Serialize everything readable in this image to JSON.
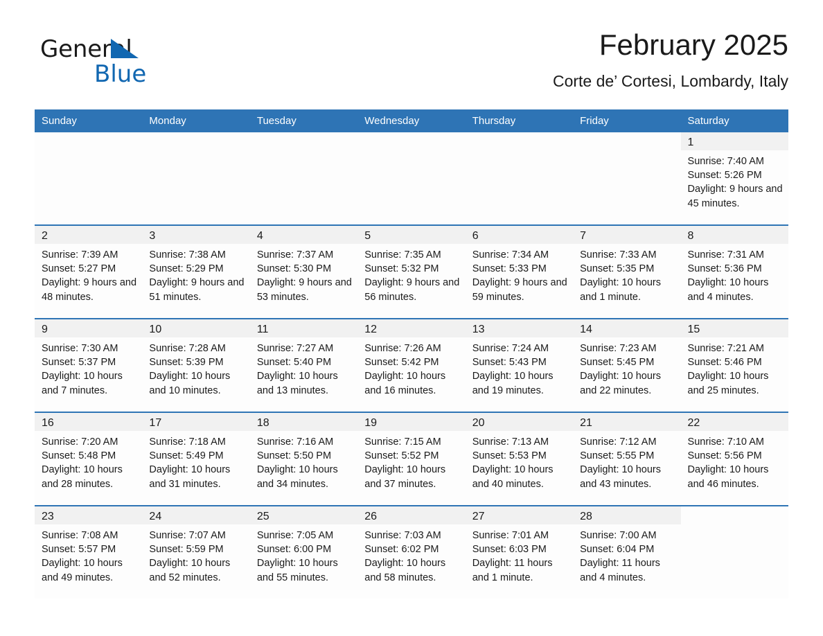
{
  "logo": {
    "word1": "General",
    "word2": "Blue",
    "triangle_color": "#1167b1",
    "text_color": "#1a1a1a"
  },
  "header": {
    "title": "February 2025",
    "subtitle": "Corte de’ Cortesi, Lombardy, Italy"
  },
  "theme": {
    "header_blue": "#2e74b5",
    "daynum_bg": "#f1f1f1",
    "cell_bg": "#fdfdfd",
    "text": "#1a1a1a"
  },
  "calendar": {
    "weekday_headers": [
      "Sunday",
      "Monday",
      "Tuesday",
      "Wednesday",
      "Thursday",
      "Friday",
      "Saturday"
    ],
    "weeks": [
      [
        {
          "day": "",
          "blank": true
        },
        {
          "day": "",
          "blank": true
        },
        {
          "day": "",
          "blank": true
        },
        {
          "day": "",
          "blank": true
        },
        {
          "day": "",
          "blank": true
        },
        {
          "day": "",
          "blank": true
        },
        {
          "day": "1",
          "sunrise": "Sunrise: 7:40 AM",
          "sunset": "Sunset: 5:26 PM",
          "daylight": "Daylight: 9 hours and 45 minutes."
        }
      ],
      [
        {
          "day": "2",
          "sunrise": "Sunrise: 7:39 AM",
          "sunset": "Sunset: 5:27 PM",
          "daylight": "Daylight: 9 hours and 48 minutes."
        },
        {
          "day": "3",
          "sunrise": "Sunrise: 7:38 AM",
          "sunset": "Sunset: 5:29 PM",
          "daylight": "Daylight: 9 hours and 51 minutes."
        },
        {
          "day": "4",
          "sunrise": "Sunrise: 7:37 AM",
          "sunset": "Sunset: 5:30 PM",
          "daylight": "Daylight: 9 hours and 53 minutes."
        },
        {
          "day": "5",
          "sunrise": "Sunrise: 7:35 AM",
          "sunset": "Sunset: 5:32 PM",
          "daylight": "Daylight: 9 hours and 56 minutes."
        },
        {
          "day": "6",
          "sunrise": "Sunrise: 7:34 AM",
          "sunset": "Sunset: 5:33 PM",
          "daylight": "Daylight: 9 hours and 59 minutes."
        },
        {
          "day": "7",
          "sunrise": "Sunrise: 7:33 AM",
          "sunset": "Sunset: 5:35 PM",
          "daylight": "Daylight: 10 hours and 1 minute."
        },
        {
          "day": "8",
          "sunrise": "Sunrise: 7:31 AM",
          "sunset": "Sunset: 5:36 PM",
          "daylight": "Daylight: 10 hours and 4 minutes."
        }
      ],
      [
        {
          "day": "9",
          "sunrise": "Sunrise: 7:30 AM",
          "sunset": "Sunset: 5:37 PM",
          "daylight": "Daylight: 10 hours and 7 minutes."
        },
        {
          "day": "10",
          "sunrise": "Sunrise: 7:28 AM",
          "sunset": "Sunset: 5:39 PM",
          "daylight": "Daylight: 10 hours and 10 minutes."
        },
        {
          "day": "11",
          "sunrise": "Sunrise: 7:27 AM",
          "sunset": "Sunset: 5:40 PM",
          "daylight": "Daylight: 10 hours and 13 minutes."
        },
        {
          "day": "12",
          "sunrise": "Sunrise: 7:26 AM",
          "sunset": "Sunset: 5:42 PM",
          "daylight": "Daylight: 10 hours and 16 minutes."
        },
        {
          "day": "13",
          "sunrise": "Sunrise: 7:24 AM",
          "sunset": "Sunset: 5:43 PM",
          "daylight": "Daylight: 10 hours and 19 minutes."
        },
        {
          "day": "14",
          "sunrise": "Sunrise: 7:23 AM",
          "sunset": "Sunset: 5:45 PM",
          "daylight": "Daylight: 10 hours and 22 minutes."
        },
        {
          "day": "15",
          "sunrise": "Sunrise: 7:21 AM",
          "sunset": "Sunset: 5:46 PM",
          "daylight": "Daylight: 10 hours and 25 minutes."
        }
      ],
      [
        {
          "day": "16",
          "sunrise": "Sunrise: 7:20 AM",
          "sunset": "Sunset: 5:48 PM",
          "daylight": "Daylight: 10 hours and 28 minutes."
        },
        {
          "day": "17",
          "sunrise": "Sunrise: 7:18 AM",
          "sunset": "Sunset: 5:49 PM",
          "daylight": "Daylight: 10 hours and 31 minutes."
        },
        {
          "day": "18",
          "sunrise": "Sunrise: 7:16 AM",
          "sunset": "Sunset: 5:50 PM",
          "daylight": "Daylight: 10 hours and 34 minutes."
        },
        {
          "day": "19",
          "sunrise": "Sunrise: 7:15 AM",
          "sunset": "Sunset: 5:52 PM",
          "daylight": "Daylight: 10 hours and 37 minutes."
        },
        {
          "day": "20",
          "sunrise": "Sunrise: 7:13 AM",
          "sunset": "Sunset: 5:53 PM",
          "daylight": "Daylight: 10 hours and 40 minutes."
        },
        {
          "day": "21",
          "sunrise": "Sunrise: 7:12 AM",
          "sunset": "Sunset: 5:55 PM",
          "daylight": "Daylight: 10 hours and 43 minutes."
        },
        {
          "day": "22",
          "sunrise": "Sunrise: 7:10 AM",
          "sunset": "Sunset: 5:56 PM",
          "daylight": "Daylight: 10 hours and 46 minutes."
        }
      ],
      [
        {
          "day": "23",
          "sunrise": "Sunrise: 7:08 AM",
          "sunset": "Sunset: 5:57 PM",
          "daylight": "Daylight: 10 hours and 49 minutes."
        },
        {
          "day": "24",
          "sunrise": "Sunrise: 7:07 AM",
          "sunset": "Sunset: 5:59 PM",
          "daylight": "Daylight: 10 hours and 52 minutes."
        },
        {
          "day": "25",
          "sunrise": "Sunrise: 7:05 AM",
          "sunset": "Sunset: 6:00 PM",
          "daylight": "Daylight: 10 hours and 55 minutes."
        },
        {
          "day": "26",
          "sunrise": "Sunrise: 7:03 AM",
          "sunset": "Sunset: 6:02 PM",
          "daylight": "Daylight: 10 hours and 58 minutes."
        },
        {
          "day": "27",
          "sunrise": "Sunrise: 7:01 AM",
          "sunset": "Sunset: 6:03 PM",
          "daylight": "Daylight: 11 hours and 1 minute."
        },
        {
          "day": "28",
          "sunrise": "Sunrise: 7:00 AM",
          "sunset": "Sunset: 6:04 PM",
          "daylight": "Daylight: 11 hours and 4 minutes."
        },
        {
          "day": "",
          "blank": true
        }
      ]
    ]
  }
}
